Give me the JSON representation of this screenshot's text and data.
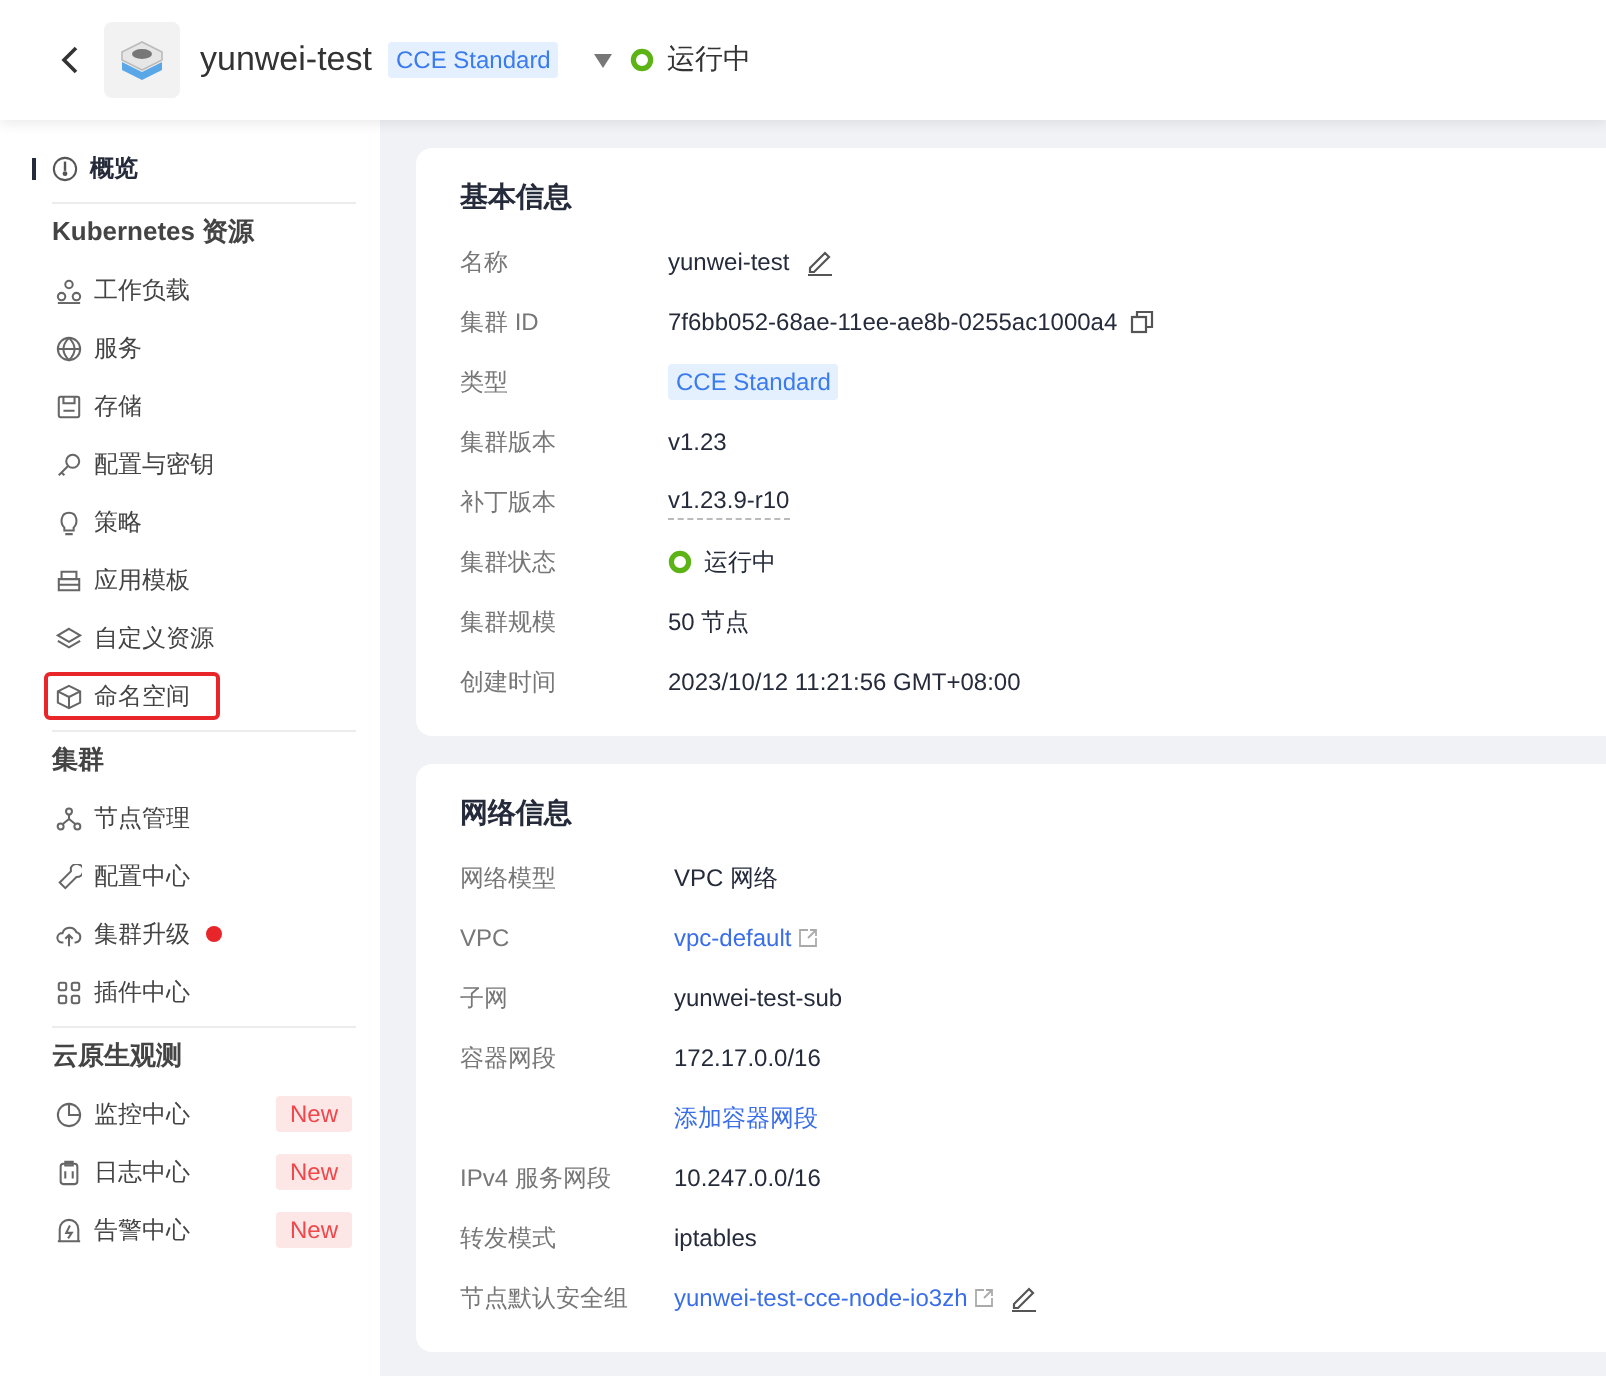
{
  "header": {
    "cluster_name": "yunwei-test",
    "type_tag": "CCE Standard",
    "status": "运行中"
  },
  "sidebar": {
    "overview": {
      "label": "概览",
      "selected": true
    },
    "sections": [
      {
        "title": "Kubernetes 资源",
        "items": [
          {
            "label": "工作负载",
            "selected": false,
            "highlighted": false
          },
          {
            "label": "服务",
            "selected": false,
            "highlighted": false
          },
          {
            "label": "存储",
            "selected": false,
            "highlighted": false
          },
          {
            "label": "配置与密钥",
            "selected": false,
            "highlighted": false
          },
          {
            "label": "策略",
            "selected": false,
            "highlighted": false
          },
          {
            "label": "应用模板",
            "selected": false,
            "highlighted": false
          },
          {
            "label": "自定义资源",
            "selected": false,
            "highlighted": false
          },
          {
            "label": "命名空间",
            "selected": false,
            "highlighted": true
          }
        ]
      },
      {
        "title": "集群",
        "items": [
          {
            "label": "节点管理",
            "selected": false,
            "highlighted": false
          },
          {
            "label": "配置中心",
            "selected": false,
            "highlighted": false
          },
          {
            "label": "集群升级",
            "selected": false,
            "highlighted": false,
            "dot": true
          },
          {
            "label": "插件中心",
            "selected": false,
            "highlighted": false
          }
        ]
      },
      {
        "title": "云原生观测",
        "items": [
          {
            "label": "监控中心",
            "selected": false,
            "highlighted": false,
            "badge": "New"
          },
          {
            "label": "日志中心",
            "selected": false,
            "highlighted": false,
            "badge": "New"
          },
          {
            "label": "告警中心",
            "selected": false,
            "highlighted": false,
            "badge": "New"
          }
        ]
      }
    ]
  },
  "cards": [
    {
      "title": "基本信息",
      "rows": [
        {
          "label": "名称",
          "kind": "text",
          "value": "yunwei-test",
          "editable": true
        },
        {
          "label": "集群 ID",
          "kind": "text",
          "value": "7f6bb052-68ae-11ee-ae8b-0255ac1000a4",
          "copyable": true
        },
        {
          "label": "类型",
          "kind": "tag",
          "value": "CCE Standard"
        },
        {
          "label": "集群版本",
          "kind": "text",
          "value": "v1.23"
        },
        {
          "label": "补丁版本",
          "kind": "hint",
          "value": "v1.23.9-r10"
        },
        {
          "label": "集群状态",
          "kind": "status",
          "value": "运行中"
        },
        {
          "label": "集群规模",
          "kind": "text",
          "value": "50 节点"
        },
        {
          "label": "创建时间",
          "kind": "text",
          "value": "2023/10/12 11:21:56 GMT+08:00"
        }
      ]
    },
    {
      "title": "网络信息",
      "rows": [
        {
          "label": "网络模型",
          "kind": "text",
          "value": "VPC 网络"
        },
        {
          "label": "VPC",
          "kind": "link",
          "value": "vpc-default",
          "external": true
        },
        {
          "label": "子网",
          "kind": "text",
          "value": "yunwei-test-sub"
        },
        {
          "label": "容器网段",
          "kind": "text",
          "value": "172.17.0.0/16"
        },
        {
          "kind": "action",
          "value": "添加容器网段"
        },
        {
          "label": "IPv4 服务网段",
          "kind": "text",
          "value": "10.247.0.0/16"
        },
        {
          "label": "转发模式",
          "kind": "text",
          "value": "iptables"
        },
        {
          "label": "节点默认安全组",
          "kind": "link",
          "value": "yunwei-test-cce-node-io3zh",
          "external": true,
          "editable": true
        }
      ]
    }
  ]
}
